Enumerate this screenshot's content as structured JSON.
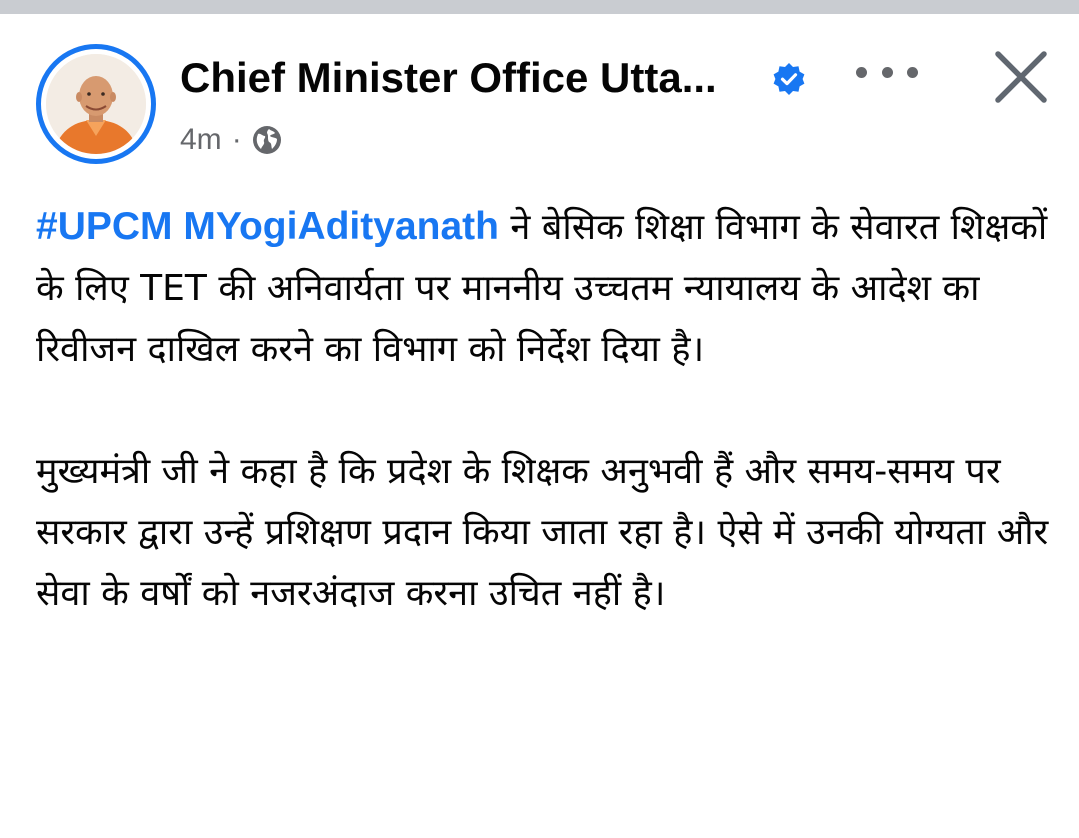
{
  "post": {
    "author": "Chief Minister Office Utta...",
    "verified": true,
    "time": "4m",
    "separator": "·",
    "audience_icon": "globe-icon",
    "more_icon": "more-options-icon",
    "close_icon": "close-icon",
    "body": {
      "hashtag": "#UPCM MYogiAdityanath",
      "paragraph1": " ने बेसिक शिक्षा विभाग के सेवारत शिक्षकों के लिए TET की अनिवार्यता पर माननीय उच्चतम न्यायालय के आदेश का रिवीजन दाखिल करने का विभाग को निर्देश दिया है।",
      "paragraph2": "मुख्यमंत्री जी ने कहा है कि प्रदेश के शिक्षक अनुभवी हैं और समय-समय पर सरकार द्वारा उन्हें प्रशिक्षण प्रदान किया जाता रहा है। ऐसे में उनकी योग्यता और सेवा के वर्षों को नजरअंदाज करना उचित नहीं है।"
    }
  },
  "colors": {
    "accent": "#1877f2",
    "meta_text": "#65676b",
    "body_text": "#050505",
    "top_strip": "#c9ccd1"
  }
}
